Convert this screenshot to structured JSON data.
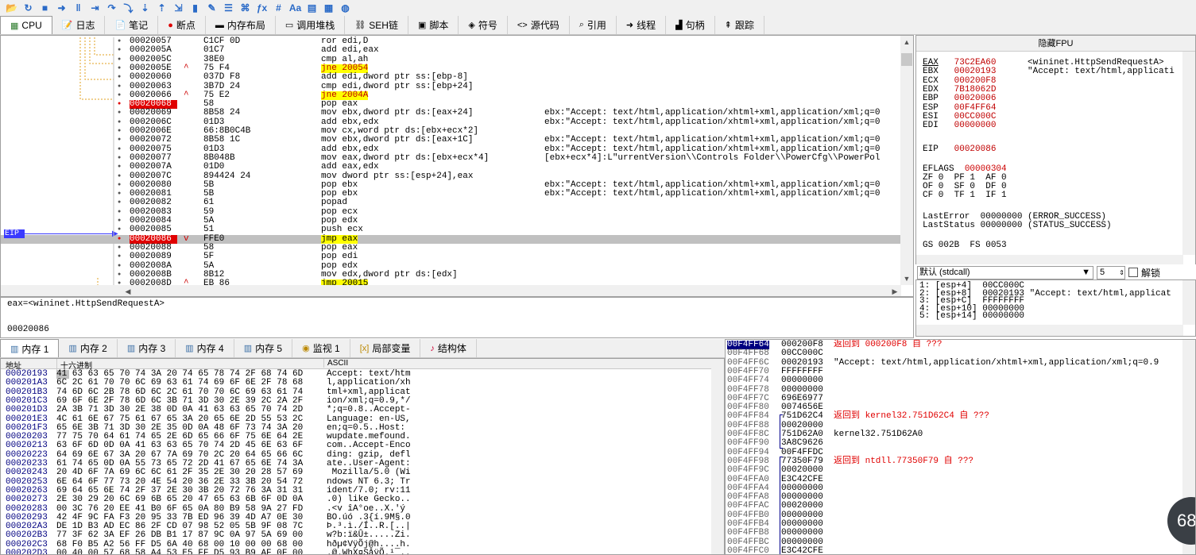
{
  "toolbar": {
    "icons": [
      "open-icon",
      "restart-icon",
      "close-icon",
      "run-icon",
      "pause-icon",
      "step-into-icon",
      "step-over-icon",
      "trace-into-icon",
      "trace-over-icon",
      "execute-till-return-icon",
      "run-to-user-icon",
      "patch-icon",
      "comment-icon",
      "label-icon",
      "bookmark-icon",
      "function-icon",
      "hash-icon",
      "font-icon",
      "memory-icon",
      "settings-icon",
      "globe-icon"
    ],
    "glyphs": [
      "📂",
      "↻",
      "■",
      "➜",
      "‖",
      "⇥",
      "↷",
      "⤵",
      "⇣",
      "⇡",
      "⇲",
      "▮",
      "✎",
      "☰",
      "⌘",
      "ƒx",
      "#",
      "Aa",
      "▤",
      "▦",
      "◍"
    ]
  },
  "tabs": [
    {
      "label": "CPU",
      "icon": "cpu-icon",
      "glyph": "▦"
    },
    {
      "label": "日志",
      "icon": "log-icon",
      "glyph": "📝"
    },
    {
      "label": "笔记",
      "icon": "notes-icon",
      "glyph": "📄"
    },
    {
      "label": "断点",
      "icon": "breakpoint-icon",
      "glyph": "●"
    },
    {
      "label": "内存布局",
      "icon": "memory-map-icon",
      "glyph": "▬"
    },
    {
      "label": "调用堆栈",
      "icon": "call-stack-icon",
      "glyph": "▭"
    },
    {
      "label": "SEH链",
      "icon": "seh-icon",
      "glyph": "⛓"
    },
    {
      "label": "脚本",
      "icon": "script-icon",
      "glyph": "▣"
    },
    {
      "label": "符号",
      "icon": "symbols-icon",
      "glyph": "◈"
    },
    {
      "label": "源代码",
      "icon": "source-icon",
      "glyph": "<>"
    },
    {
      "label": "引用",
      "icon": "references-icon",
      "glyph": "⌕"
    },
    {
      "label": "线程",
      "icon": "threads-icon",
      "glyph": "➜"
    },
    {
      "label": "句柄",
      "icon": "handles-icon",
      "glyph": "▟"
    },
    {
      "label": "跟踪",
      "icon": "trace-icon",
      "glyph": "⇞"
    }
  ],
  "disasm": [
    {
      "addr": "00020057",
      "bytes": "C1CF 0D",
      "instr": "ror edi,D",
      "cmt": ""
    },
    {
      "addr": "0002005A",
      "bytes": "01C7",
      "instr": "add edi,eax",
      "cmt": ""
    },
    {
      "addr": "0002005C",
      "bytes": "38E0",
      "instr": "cmp al,ah",
      "cmt": ""
    },
    {
      "addr": "0002005E",
      "bytes": "75 F4",
      "instr": "jne 20054",
      "cmt": "",
      "jmp": "^",
      "hl": "jcc"
    },
    {
      "addr": "00020060",
      "bytes": "037D F8",
      "instr": "add edi,dword ptr ss:[ebp-8]",
      "cmt": ""
    },
    {
      "addr": "00020063",
      "bytes": "3B7D 24",
      "instr": "cmp edi,dword ptr ss:[ebp+24]",
      "cmt": ""
    },
    {
      "addr": "00020066",
      "bytes": "75 E2",
      "instr": "jne 2004A",
      "cmt": "",
      "jmp": "^",
      "hl": "jcc"
    },
    {
      "addr": "00020068",
      "bytes": "58",
      "instr": "pop eax",
      "cmt": "",
      "bp": true
    },
    {
      "addr": "00020069",
      "bytes": "8B58 24",
      "instr": "mov ebx,dword ptr ds:[eax+24]",
      "cmt": "ebx:\"Accept: text/html,application/xhtml+xml,application/xml;q=0"
    },
    {
      "addr": "0002006C",
      "bytes": "01D3",
      "instr": "add ebx,edx",
      "cmt": "ebx:\"Accept: text/html,application/xhtml+xml,application/xml;q=0"
    },
    {
      "addr": "0002006E",
      "bytes": "66:8B0C4B",
      "instr": "mov cx,word ptr ds:[ebx+ecx*2]",
      "cmt": ""
    },
    {
      "addr": "00020072",
      "bytes": "8B58 1C",
      "instr": "mov ebx,dword ptr ds:[eax+1C]",
      "cmt": "ebx:\"Accept: text/html,application/xhtml+xml,application/xml;q=0"
    },
    {
      "addr": "00020075",
      "bytes": "01D3",
      "instr": "add ebx,edx",
      "cmt": "ebx:\"Accept: text/html,application/xhtml+xml,application/xml;q=0"
    },
    {
      "addr": "00020077",
      "bytes": "8B048B",
      "instr": "mov eax,dword ptr ds:[ebx+ecx*4]",
      "cmt": "[ebx+ecx*4]:L\"urrentVersion\\\\Controls Folder\\\\PowerCfg\\\\PowerPol"
    },
    {
      "addr": "0002007A",
      "bytes": "01D0",
      "instr": "add eax,edx",
      "cmt": ""
    },
    {
      "addr": "0002007C",
      "bytes": "894424 24",
      "instr": "mov dword ptr ss:[esp+24],eax",
      "cmt": ""
    },
    {
      "addr": "00020080",
      "bytes": "5B",
      "instr": "pop ebx",
      "cmt": "ebx:\"Accept: text/html,application/xhtml+xml,application/xml;q=0"
    },
    {
      "addr": "00020081",
      "bytes": "5B",
      "instr": "pop ebx",
      "cmt": "ebx:\"Accept: text/html,application/xhtml+xml,application/xml;q=0"
    },
    {
      "addr": "00020082",
      "bytes": "61",
      "instr": "popad",
      "cmt": ""
    },
    {
      "addr": "00020083",
      "bytes": "59",
      "instr": "pop ecx",
      "cmt": ""
    },
    {
      "addr": "00020084",
      "bytes": "5A",
      "instr": "pop edx",
      "cmt": ""
    },
    {
      "addr": "00020085",
      "bytes": "51",
      "instr": "push ecx",
      "cmt": ""
    },
    {
      "addr": "00020086",
      "bytes": "FFE0",
      "instr": "jmp eax",
      "cmt": "",
      "bp": true,
      "eip": true,
      "jmp": "v",
      "hl": "jmp"
    },
    {
      "addr": "00020088",
      "bytes": "58",
      "instr": "pop eax",
      "cmt": ""
    },
    {
      "addr": "00020089",
      "bytes": "5F",
      "instr": "pop edi",
      "cmt": ""
    },
    {
      "addr": "0002008A",
      "bytes": "5A",
      "instr": "pop edx",
      "cmt": ""
    },
    {
      "addr": "0002008B",
      "bytes": "8B12",
      "instr": "mov edx,dword ptr ds:[edx]",
      "cmt": ""
    },
    {
      "addr": "0002008D",
      "bytes": "EB 86",
      "instr": "jmp 20015",
      "cmt": "",
      "jmp": "^",
      "hl": "jmp"
    }
  ],
  "eip_label": "EIP",
  "registers": {
    "title": "隐藏FPU",
    "rows": [
      {
        "name": "EAX",
        "val": "73C2EA60",
        "cmt": "<wininet.HttpSendRequestA>"
      },
      {
        "name": "EBX",
        "val": "00020193",
        "cmt": "\"Accept: text/html,applicati"
      },
      {
        "name": "ECX",
        "val": "000200F8",
        "cmt": ""
      },
      {
        "name": "EDX",
        "val": "7B18062D",
        "cmt": ""
      },
      {
        "name": "EBP",
        "val": "00020006",
        "cmt": ""
      },
      {
        "name": "ESP",
        "val": "00F4FF64",
        "cmt": ""
      },
      {
        "name": "ESI",
        "val": "00CC000C",
        "cmt": ""
      },
      {
        "name": "EDI",
        "val": "00000000",
        "cmt": ""
      }
    ],
    "eip": {
      "name": "EIP",
      "val": "00020086"
    },
    "eflags": {
      "name": "EFLAGS",
      "val": "00000304"
    },
    "flags": [
      "ZF 0  PF 1  AF 0",
      "OF 0  SF 0  DF 0",
      "CF 0  TF 1  IF 1"
    ],
    "last_error": "LastError  00000000 (ERROR_SUCCESS)",
    "last_status": "LastStatus 00000000 (STATUS_SUCCESS)",
    "segs": "GS 002B  FS 0053"
  },
  "callconv": {
    "selected": "默认 (stdcall)",
    "count": "5",
    "unlock_label": "解锁"
  },
  "stackargs": [
    "1: [esp+4]  00CC000C",
    "2: [esp+8]  00020193 \"Accept: text/html,applicat",
    "3: [esp+C]  FFFFFFFF",
    "4: [esp+10] 00000000",
    "5: [esp+14] 00000000"
  ],
  "info": {
    "line1": "eax=<wininet.HttpSendRequestA>",
    "line2": "00020086"
  },
  "memtabs": [
    {
      "label": "内存 1",
      "icon": "memory-icon"
    },
    {
      "label": "内存 2",
      "icon": "memory-icon"
    },
    {
      "label": "内存 3",
      "icon": "memory-icon"
    },
    {
      "label": "内存 4",
      "icon": "memory-icon"
    },
    {
      "label": "内存 5",
      "icon": "memory-icon"
    },
    {
      "label": "监视 1",
      "icon": "watch-icon"
    },
    {
      "label": "局部变量",
      "icon": "locals-icon"
    },
    {
      "label": "结构体",
      "icon": "struct-icon"
    }
  ],
  "dump": {
    "headers": {
      "addr": "地址",
      "hex": "十六进制",
      "ascii": "ASCII"
    },
    "rows": [
      {
        "addr": "00020193",
        "hex": "41 63 63 65 70 74 3A 20 74 65 78 74 2F 68 74 6D",
        "ascii": "Accept: text/htm"
      },
      {
        "addr": "000201A3",
        "hex": "6C 2C 61 70 70 6C 69 63 61 74 69 6F 6E 2F 78 68",
        "ascii": "l,application/xh"
      },
      {
        "addr": "000201B3",
        "hex": "74 6D 6C 2B 78 6D 6C 2C 61 70 70 6C 69 63 61 74",
        "ascii": "tml+xml,applicat"
      },
      {
        "addr": "000201C3",
        "hex": "69 6F 6E 2F 78 6D 6C 3B 71 3D 30 2E 39 2C 2A 2F",
        "ascii": "ion/xml;q=0.9,*/"
      },
      {
        "addr": "000201D3",
        "hex": "2A 3B 71 3D 30 2E 38 0D 0A 41 63 63 65 70 74 2D",
        "ascii": "*;q=0.8..Accept-"
      },
      {
        "addr": "000201E3",
        "hex": "4C 61 6E 67 75 61 67 65 3A 20 65 6E 2D 55 53 2C",
        "ascii": "Language: en-US,"
      },
      {
        "addr": "000201F3",
        "hex": "65 6E 3B 71 3D 30 2E 35 0D 0A 48 6F 73 74 3A 20",
        "ascii": "en;q=0.5..Host: "
      },
      {
        "addr": "00020203",
        "hex": "77 75 70 64 61 74 65 2E 6D 65 66 6F 75 6E 64 2E",
        "ascii": "wupdate.mefound."
      },
      {
        "addr": "00020213",
        "hex": "63 6F 6D 0D 0A 41 63 63 65 70 74 2D 45 6E 63 6F",
        "ascii": "com..Accept-Enco"
      },
      {
        "addr": "00020223",
        "hex": "64 69 6E 67 3A 20 67 7A 69 70 2C 20 64 65 66 6C",
        "ascii": "ding: gzip, defl"
      },
      {
        "addr": "00020233",
        "hex": "61 74 65 0D 0A 55 73 65 72 2D 41 67 65 6E 74 3A",
        "ascii": "ate..User-Agent:"
      },
      {
        "addr": "00020243",
        "hex": "20 4D 6F 7A 69 6C 6C 61 2F 35 2E 30 20 28 57 69",
        "ascii": " Mozilla/5.0 (Wi"
      },
      {
        "addr": "00020253",
        "hex": "6E 64 6F 77 73 20 4E 54 20 36 2E 33 3B 20 54 72",
        "ascii": "ndows NT 6.3; Tr"
      },
      {
        "addr": "00020263",
        "hex": "69 64 65 6E 74 2F 37 2E 30 3B 20 72 76 3A 31 31",
        "ascii": "ident/7.0; rv:11"
      },
      {
        "addr": "00020273",
        "hex": "2E 30 29 20 6C 69 6B 65 20 47 65 63 6B 6F 0D 0A",
        "ascii": ".0) like Gecko.."
      },
      {
        "addr": "00020283",
        "hex": "00 3C 76 20 EE 41 B0 6F 65 0A 80 B9 58 9A 27 FD",
        "ascii": ".<v îA°oe..X.'ý"
      },
      {
        "addr": "00020293",
        "hex": "42 4F 9C FA F3 20 95 33 7B ED 96 39 4D A7 0E 30",
        "ascii": "BO.úó .3{í.9M§.0"
      },
      {
        "addr": "000202A3",
        "hex": "DE 1D B3 AD EC 86 2F CD 07 98 52 05 5B 9F 08 7C",
        "ascii": "Þ.³.ì./Í..R.[..|"
      },
      {
        "addr": "000202B3",
        "hex": "77 3F 62 3A EF 26 DB B1 17 87 9C 0A 97 5A 69 00",
        "ascii": "w?b:ï&Û±.....Zi."
      },
      {
        "addr": "000202C3",
        "hex": "68 F0 B5 A2 56 FF D5 6A 40 68 00 10 00 00 68 00",
        "ascii": "hðµ¢VÿÕj@h....h."
      },
      {
        "addr": "000202D3",
        "hex": "00 40 00 57 68 58 A4 53 E5 FF D5 93 B9 AF 0F 00",
        "ascii": ".@.WhX¤SåÿÕ.¹¯.."
      }
    ]
  },
  "stack": [
    {
      "addr": "00F4FF64",
      "val": "000200F8",
      "cmt": "返回到 000200F8 自 ???",
      "cur": true,
      "red": true
    },
    {
      "addr": "00F4FF68",
      "val": "00CC000C",
      "cmt": ""
    },
    {
      "addr": "00F4FF6C",
      "val": "00020193",
      "cmt": "\"Accept: text/html,application/xhtml+xml,application/xml;q=0.9"
    },
    {
      "addr": "00F4FF70",
      "val": "FFFFFFFF",
      "cmt": ""
    },
    {
      "addr": "00F4FF74",
      "val": "00000000",
      "cmt": ""
    },
    {
      "addr": "00F4FF78",
      "val": "00000000",
      "cmt": ""
    },
    {
      "addr": "00F4FF7C",
      "val": "696E6977",
      "cmt": ""
    },
    {
      "addr": "00F4FF80",
      "val": "0074656E",
      "cmt": ""
    },
    {
      "addr": "00F4FF84",
      "val": "751D62C4",
      "cmt": "返回到 kernel32.751D62C4 自 ???",
      "red": true
    },
    {
      "addr": "00F4FF88",
      "val": "00020000",
      "cmt": ""
    },
    {
      "addr": "00F4FF8C",
      "val": "751D62A0",
      "cmt": "kernel32.751D62A0"
    },
    {
      "addr": "00F4FF90",
      "val": "3A8C9626",
      "cmt": ""
    },
    {
      "addr": "00F4FF94",
      "val": "00F4FFDC",
      "cmt": ""
    },
    {
      "addr": "00F4FF98",
      "val": "77350F79",
      "cmt": "返回到 ntdll.77350F79 自 ???",
      "red": true
    },
    {
      "addr": "00F4FF9C",
      "val": "00020000",
      "cmt": ""
    },
    {
      "addr": "00F4FFA0",
      "val": "E3C42CFE",
      "cmt": ""
    },
    {
      "addr": "00F4FFA4",
      "val": "00000000",
      "cmt": ""
    },
    {
      "addr": "00F4FFA8",
      "val": "00000000",
      "cmt": ""
    },
    {
      "addr": "00F4FFAC",
      "val": "00020000",
      "cmt": ""
    },
    {
      "addr": "00F4FFB0",
      "val": "00000000",
      "cmt": ""
    },
    {
      "addr": "00F4FFB4",
      "val": "00000000",
      "cmt": ""
    },
    {
      "addr": "00F4FFB8",
      "val": "00000000",
      "cmt": ""
    },
    {
      "addr": "00F4FFBC",
      "val": "00000000",
      "cmt": ""
    },
    {
      "addr": "00F4FFC0",
      "val": "E3C42CFE",
      "cmt": ""
    }
  ],
  "badge": "68",
  "colors": {
    "bp": "#e00000",
    "eip": "#3333ff",
    "jcc_hl": "#ffff00",
    "red_cmt": "#e00000",
    "addr_blue": "#000080"
  }
}
